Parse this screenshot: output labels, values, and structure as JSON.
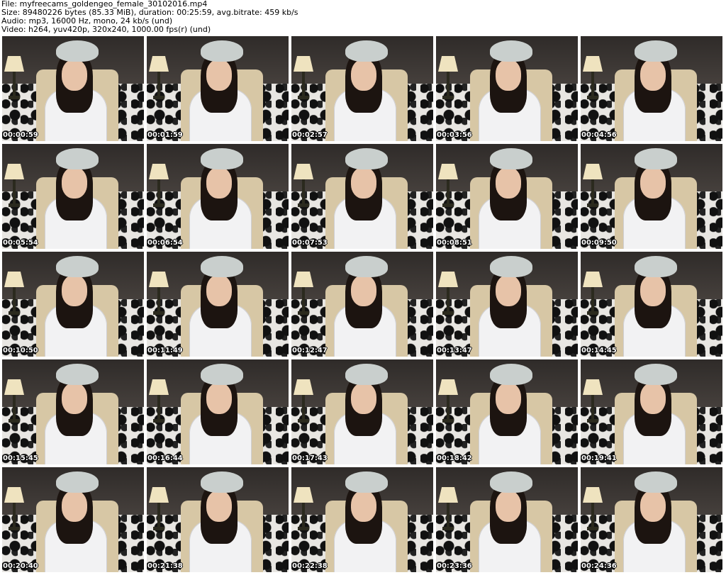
{
  "header": {
    "file_line": "File: myfreecams_goldengeo_female_30102016.mp4",
    "size_line": "Size: 89480226 bytes (85.33 MiB), duration: 00:25:59, avg.bitrate: 459 kb/s",
    "audio_line": "Audio: mp3, 16000 Hz, mono, 24 kb/s (und)",
    "video_line": "Video: h264, yuv420p, 320x240, 1000.00 fps(r) (und)"
  },
  "thumbnails": [
    {
      "time": "00:00:59"
    },
    {
      "time": "00:01:59"
    },
    {
      "time": "00:02:57"
    },
    {
      "time": "00:03:56"
    },
    {
      "time": "00:04:56"
    },
    {
      "time": "00:05:54"
    },
    {
      "time": "00:06:54"
    },
    {
      "time": "00:07:53"
    },
    {
      "time": "00:08:51"
    },
    {
      "time": "00:09:50"
    },
    {
      "time": "00:10:50"
    },
    {
      "time": "00:11:49"
    },
    {
      "time": "00:12:47"
    },
    {
      "time": "00:13:47"
    },
    {
      "time": "00:14:45"
    },
    {
      "time": "00:15:45"
    },
    {
      "time": "00:16:44"
    },
    {
      "time": "00:17:43"
    },
    {
      "time": "00:18:42"
    },
    {
      "time": "00:19:41"
    },
    {
      "time": "00:20:40"
    },
    {
      "time": "00:21:38"
    },
    {
      "time": "00:22:38"
    },
    {
      "time": "00:23:36"
    },
    {
      "time": "00:24:36"
    }
  ]
}
